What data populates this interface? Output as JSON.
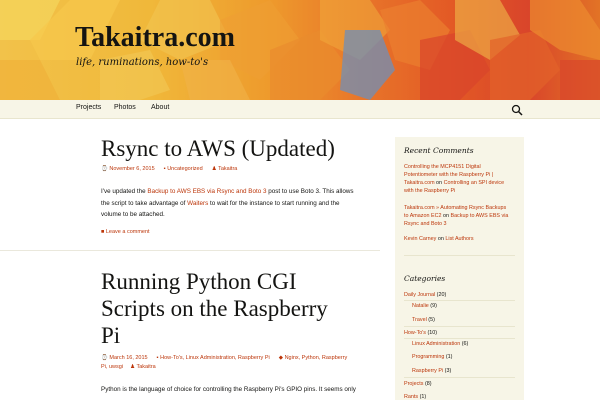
{
  "site": {
    "title": "Takaitra.com",
    "description": "life, ruminations, how-to's"
  },
  "nav": {
    "items": [
      "Projects",
      "Photos",
      "About"
    ]
  },
  "posts": [
    {
      "title": "Rsync to AWS (Updated)",
      "date": "November 6, 2015",
      "category": "Uncategorized",
      "author": "Takaitra",
      "body_1": "I've updated the ",
      "body_link_1": "Backup to AWS EBS via Rsync and Boto 3",
      "body_2": " post to use Boto 3. This allows",
      "body_3": "the script to take advantage of ",
      "body_link_2": "Waiters",
      "body_4": " to wait for the instance to start running and the",
      "body_5": "volume to be attached.",
      "comment": "Leave a comment"
    },
    {
      "title_line1": "Running Python CGI",
      "title_line2": "Scripts on the Raspberry",
      "title_line3": "Pi",
      "date": "March 16, 2015",
      "categories": "How-To's, Linux Administration, Raspberry Pi",
      "tags_1": "Nginx, Python, Raspberry",
      "tags_2": "Pi, uwsgi",
      "author": "Takaitra",
      "body_1": "Python is the language of choice for controlling the Raspberry Pi's GPIO pins. It seems only"
    }
  ],
  "sidebar": {
    "recent_comments_title": "Recent Comments",
    "recent_comments": [
      {
        "l1": "Controlling the MCP4151 Digital",
        "l2": "Potentiometer with the Raspberry Pi |",
        "l3a": "Takaitra.com",
        "l3b": " on ",
        "l3c": "Controlling an SPI device",
        "l4": "with the Raspberry Pi"
      },
      {
        "l1": "Takaitra.com » Automating Rsync Backups",
        "l2a": "to Amazon EC2",
        "l2b": " on ",
        "l2c": "Backup to AWS EBS via",
        "l3": "Rsync and Boto 3"
      },
      {
        "a": "Kevin Carney",
        "b": " on ",
        "c": "List Authors"
      }
    ],
    "categories_title": "Categories",
    "categories": [
      {
        "name": "Daily Journal",
        "count": " (20)"
      },
      {
        "name": "Natalie",
        "count": " (9)"
      },
      {
        "name": "Travel",
        "count": " (5)"
      },
      {
        "name": "How-To's",
        "count": " (10)"
      },
      {
        "name": "Linux Administration",
        "count": " (6)"
      },
      {
        "name": "Programming",
        "count": " (1)"
      },
      {
        "name": "Raspberry Pi",
        "count": " (3)"
      },
      {
        "name": "Projects",
        "count": " (8)"
      },
      {
        "name": "Rants",
        "count": " (1)"
      }
    ]
  },
  "colors": {
    "link": "#bc360a",
    "sidebar_bg": "#f7f5e7",
    "navbar_bg": "#f7f5e7"
  },
  "icons": {
    "search": "search-icon",
    "calendar": "calendar-icon",
    "folder": "folder-icon",
    "person": "person-icon",
    "tag": "tag-icon",
    "comment": "comment-icon"
  }
}
